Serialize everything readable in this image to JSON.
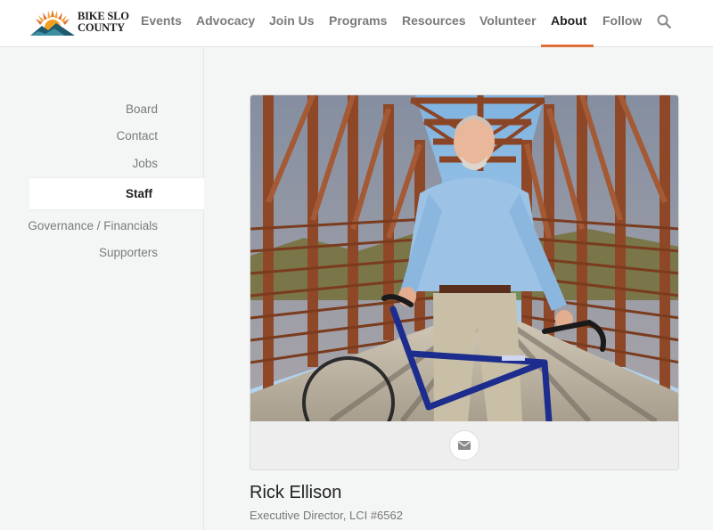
{
  "brand": {
    "line1": "BIKE SLO",
    "line2": "COUNTY"
  },
  "nav": {
    "items": [
      {
        "label": "Events"
      },
      {
        "label": "Advocacy"
      },
      {
        "label": "Join Us"
      },
      {
        "label": "Programs"
      },
      {
        "label": "Resources"
      },
      {
        "label": "Volunteer"
      },
      {
        "label": "About"
      },
      {
        "label": "Follow"
      }
    ],
    "active": "About",
    "search_icon": "search-icon"
  },
  "sidebar": {
    "items": [
      {
        "label": "Board"
      },
      {
        "label": "Contact"
      },
      {
        "label": "Jobs"
      },
      {
        "label": "Staff"
      },
      {
        "label": "Governance / Financials"
      },
      {
        "label": "Supporters"
      }
    ],
    "active": "Staff"
  },
  "staff": {
    "name": "Rick Ellison",
    "title": "Executive Director, LCI #6562",
    "contact_icon": "envelope-icon"
  },
  "colors": {
    "accent": "#e0703a",
    "background": "#f4f5f5",
    "header": "#ffffff"
  }
}
